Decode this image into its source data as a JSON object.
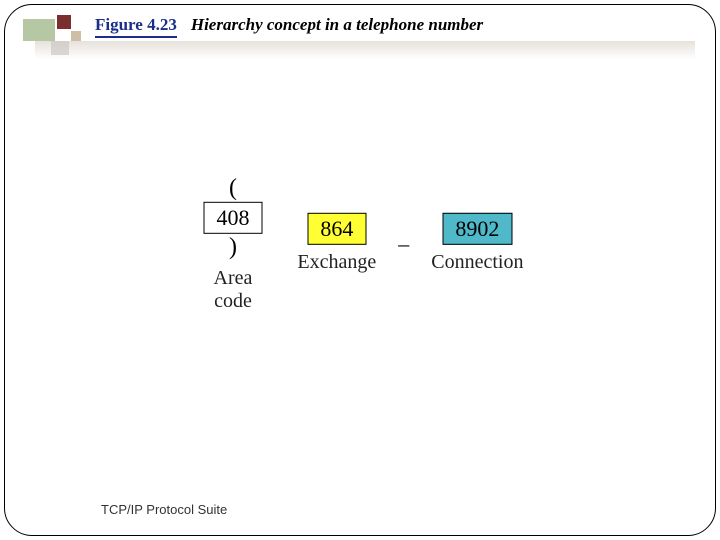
{
  "header": {
    "figure_label": "Figure 4.23",
    "caption": "Hierarchy concept in a telephone number"
  },
  "phone": {
    "open_paren": "(",
    "close_paren": ")",
    "separator": "–",
    "parts": {
      "area_code": {
        "value": "408",
        "label": "Area code"
      },
      "exchange": {
        "value": "864",
        "label": "Exchange"
      },
      "connection": {
        "value": "8902",
        "label": "Connection"
      }
    }
  },
  "footer": {
    "text": "TCP/IP Protocol Suite"
  },
  "colors": {
    "accent_blue": "#1a2e8a",
    "highlight_yellow": "#ffff33",
    "highlight_teal": "#4fb8c9"
  }
}
